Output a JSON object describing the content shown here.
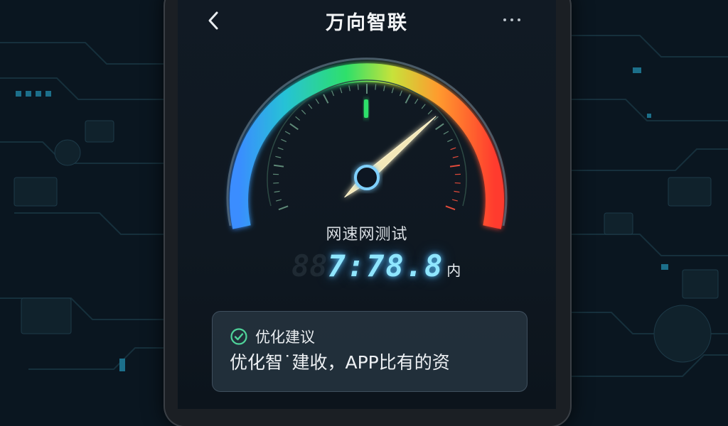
{
  "header": {
    "title": "万向智联",
    "back_icon": "chevron-left-icon",
    "more_icon": "more-horizontal-icon"
  },
  "speed_test": {
    "caption": "网速网测试",
    "value_ghost": "88",
    "value": "7:78.8",
    "unit": "内",
    "needle_level": 0.72,
    "colors": {
      "arc_start": "#3a8dff",
      "arc_mid": "#2ee06a",
      "arc_end": "#ff3b2f",
      "readout": "#8fe6ff"
    }
  },
  "advice": {
    "icon": "check-circle-icon",
    "title": "优化建议",
    "body": "优化智˙建收，APP比有的资"
  }
}
